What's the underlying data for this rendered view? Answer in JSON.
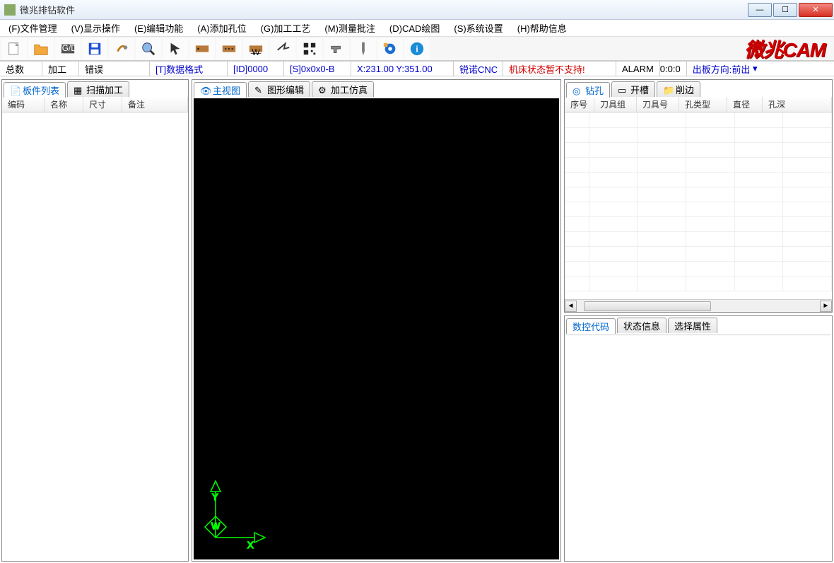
{
  "title": "微兆排钻软件",
  "menu": {
    "file": "(F)文件管理",
    "view": "(V)显示操作",
    "edit": "(E)编辑功能",
    "add": "(A)添加孔位",
    "proc": "(G)加工工艺",
    "meas": "(M)测量批注",
    "cad": "(D)CAD绘图",
    "sys": "(S)系统设置",
    "help": "(H)帮助信息"
  },
  "logo": "微兆CAM",
  "status": {
    "total": "总数",
    "work": "加工",
    "error": "错误",
    "fmt": "[T]数据格式",
    "id": "[ID]0000",
    "s": "[S]0x0x0-B",
    "xy": "X:231.00 Y:351.00",
    "cnc": "锐诺CNC",
    "mach": "机床状态暂不支持!",
    "alarm": "ALARM",
    "time": "0:0:0",
    "out": "出板方向:前出"
  },
  "left": {
    "tabs": {
      "list": "板件列表",
      "scan": "扫描加工"
    },
    "cols": {
      "c1": "编码",
      "c2": "名称",
      "c3": "尺寸",
      "c4": "备注"
    }
  },
  "center": {
    "tabs": {
      "main": "主视图",
      "geom": "图形编辑",
      "sim": "加工仿真"
    }
  },
  "right": {
    "top": {
      "tabs": {
        "drill": "钻孔",
        "slot": "开槽",
        "cut": "削边"
      },
      "cols": {
        "c1": "序号",
        "c2": "刀具组",
        "c3": "刀具号",
        "c4": "孔类型",
        "c5": "直径",
        "c6": "孔深"
      }
    },
    "bot": {
      "tabs": {
        "code": "数控代码",
        "state": "状态信息",
        "sel": "选择属性"
      }
    }
  }
}
